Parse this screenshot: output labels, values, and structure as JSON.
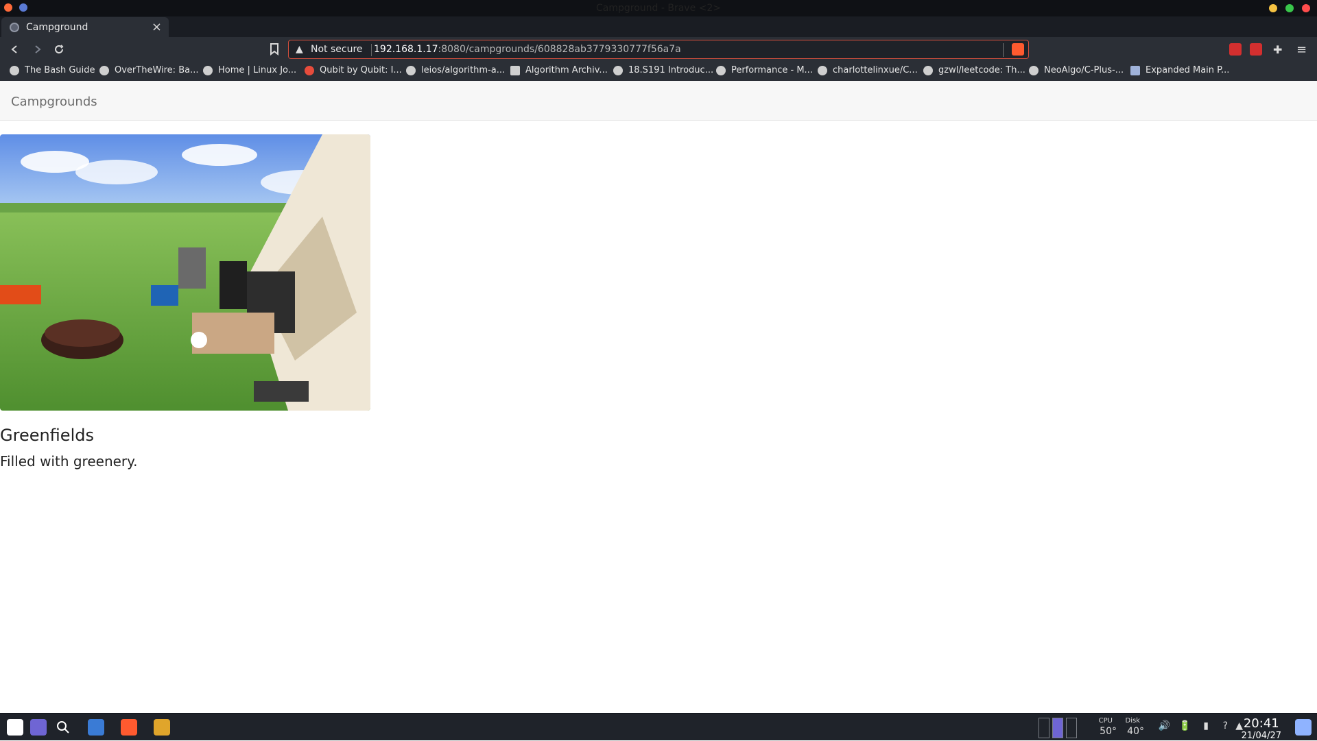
{
  "window": {
    "title": "Campground - Brave <2>"
  },
  "tabs": [
    {
      "label": "Campground"
    }
  ],
  "toolbar": {
    "not_secure_label": "Not secure",
    "url_host": "192.168.1.17",
    "url_path": ":8080/campgrounds/608828ab3779330777f56a7a"
  },
  "bookmarks": [
    {
      "label": "The Bash Guide"
    },
    {
      "label": "OverTheWire: Ba..."
    },
    {
      "label": "Home | Linux Jo..."
    },
    {
      "label": "Qubit by Qubit: I..."
    },
    {
      "label": "leios/algorithm-a..."
    },
    {
      "label": "Algorithm Archiv..."
    },
    {
      "label": "18.S191 Introduc..."
    },
    {
      "label": "Performance - M..."
    },
    {
      "label": "charlottelinxue/C..."
    },
    {
      "label": "gzwl/leetcode: Th..."
    },
    {
      "label": "NeoAlgo/C-Plus-..."
    },
    {
      "label": "Expanded Main P..."
    }
  ],
  "page": {
    "navbar_brand": "Campgrounds",
    "campground": {
      "title": "Greenfields",
      "description": "Filled with greenery."
    }
  },
  "taskbar": {
    "cpu_label": "CPU",
    "cpu_temp": "50°",
    "disk_label": "Disk",
    "disk_temp": "40°",
    "time": "20:41",
    "date": "21/04/27"
  }
}
